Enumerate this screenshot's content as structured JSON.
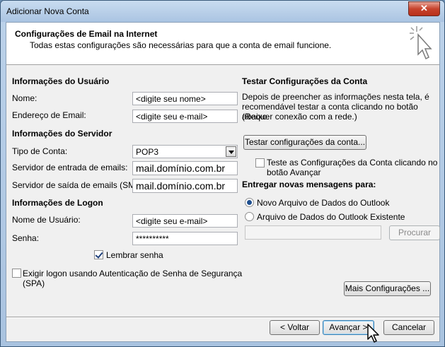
{
  "window": {
    "title": "Adicionar Nova Conta",
    "close_label": "✕"
  },
  "header": {
    "title": "Configurações de Email na Internet",
    "subtitle": "Todas estas configurações são necessárias para que a conta de email funcione."
  },
  "user_info": {
    "section": "Informações do Usuário",
    "name_label": "Nome:",
    "name_value": "<digite seu nome>",
    "email_label": "Endereço de Email:",
    "email_value": "<digite seu e-mail>"
  },
  "server_info": {
    "section": "Informações do Servidor",
    "account_type_label": "Tipo de Conta:",
    "account_type_value": "POP3",
    "incoming_label": "Servidor de entrada de emails:",
    "incoming_value": "mail.domínio.com.br",
    "outgoing_label": "Servidor de saída de emails (SMTP):",
    "outgoing_value": "mail.domínio.com.br"
  },
  "logon_info": {
    "section": "Informações de Logon",
    "username_label": "Nome de Usuário:",
    "username_value": "<digite seu e-mail>",
    "password_label": "Senha:",
    "password_value": "**********",
    "remember_label": "Lembrar senha",
    "remember_checked": true,
    "spa_label_line1": "Exigir logon usando Autenticação de Senha de Segurança",
    "spa_label_line2": "(SPA)",
    "spa_checked": false
  },
  "test": {
    "section": "Testar Configurações da Conta",
    "description_line1": "Depois de preencher as informações nesta tela, é",
    "description_line2": "recomendável testar a conta clicando no botão abaixo.",
    "description_line3": "(Requer conexão com a rede.)",
    "test_button": "Testar configurações da conta...",
    "auto_test_line1": "Teste as Configurações da Conta clicando no",
    "auto_test_line2": "botão Avançar",
    "auto_test_checked": false
  },
  "delivery": {
    "section": "Entregar novas mensagens para:",
    "new_file_label": "Novo Arquivo de Dados do Outlook",
    "existing_file_label": "Arquivo de Dados do Outlook Existente",
    "existing_path": "",
    "browse_button": "Procurar",
    "selected": "new"
  },
  "more_settings_button": "Mais Configurações ...",
  "footer": {
    "back_button": "< Voltar",
    "next_button": "Avançar >",
    "cancel_button": "Cancelar"
  }
}
